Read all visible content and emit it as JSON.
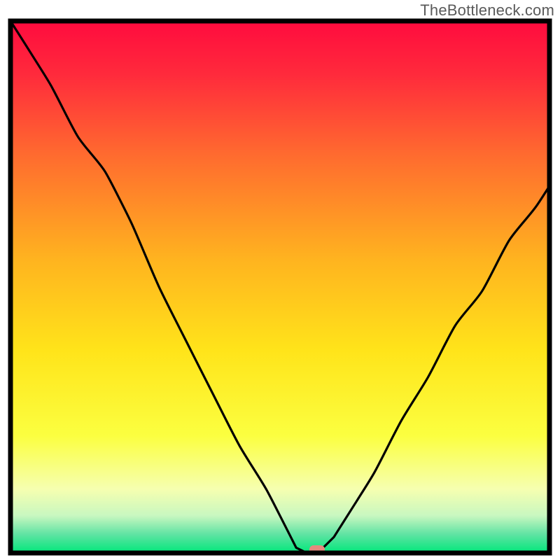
{
  "watermark": "TheBottleneck.com",
  "chart_data": {
    "type": "line",
    "title": "",
    "xlabel": "",
    "ylabel": "",
    "xlim": [
      0,
      100
    ],
    "ylim": [
      0,
      100
    ],
    "x": [
      0,
      5,
      10,
      15,
      20,
      25,
      30,
      35,
      40,
      45,
      50,
      53,
      55,
      57,
      60,
      65,
      70,
      75,
      80,
      85,
      90,
      95,
      100
    ],
    "values": [
      100,
      92,
      83,
      75,
      67,
      56,
      45,
      35,
      25,
      16,
      7,
      1,
      0,
      0,
      3,
      11,
      20,
      29,
      38,
      46,
      54,
      62,
      69
    ],
    "curve_note": "Bottleneck percentage curve; V-shaped with minimum around x≈55–57, left arm steeper with slight upper-left curvature, right arm nearly linear.",
    "marker": {
      "x": 57,
      "y": 0.5,
      "shape": "rounded-rect",
      "color": "#e58a7e"
    },
    "background": {
      "type": "vertical-gradient",
      "stops": [
        {
          "pos": 0.0,
          "color": "#ff0b3e"
        },
        {
          "pos": 0.1,
          "color": "#ff2a3c"
        },
        {
          "pos": 0.25,
          "color": "#ff6a2f"
        },
        {
          "pos": 0.45,
          "color": "#ffb41f"
        },
        {
          "pos": 0.62,
          "color": "#ffe41a"
        },
        {
          "pos": 0.78,
          "color": "#fbff40"
        },
        {
          "pos": 0.88,
          "color": "#f6ffb0"
        },
        {
          "pos": 0.93,
          "color": "#c8f7c0"
        },
        {
          "pos": 0.965,
          "color": "#5fe3a3"
        },
        {
          "pos": 1.0,
          "color": "#00e77a"
        }
      ]
    },
    "frame_color": "#000000",
    "curve_color": "#000000"
  }
}
